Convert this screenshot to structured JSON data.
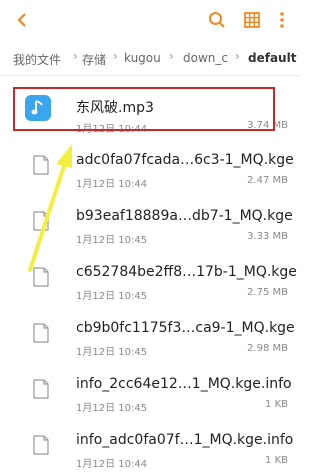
{
  "breadcrumb": {
    "items": [
      "我的文件",
      "存储",
      "kugou",
      "down_c",
      "default"
    ]
  },
  "files": [
    {
      "name": "东风破.mp3",
      "date": "1月12日 10:44",
      "size": "3.74 MB",
      "type": "audio"
    },
    {
      "name": "adc0fa07fcada…6c3-1_MQ.kge",
      "date": "1月12日 10:44",
      "size": "2.47 MB",
      "type": "file"
    },
    {
      "name": "b93eaf18889a…db7-1_MQ.kge",
      "date": "1月12日 10:45",
      "size": "3.33 MB",
      "type": "file"
    },
    {
      "name": "c652784be2ff8…17b-1_MQ.kge",
      "date": "1月12日 10:45",
      "size": "2.75 MB",
      "type": "file"
    },
    {
      "name": "cb9b0fc1175f3…ca9-1_MQ.kge",
      "date": "1月12日 10:45",
      "size": "2.98 MB",
      "type": "file"
    },
    {
      "name": "info_2cc64e12…1_MQ.kge.info",
      "date": "1月12日 10:45",
      "size": "1 KB",
      "type": "file"
    },
    {
      "name": "info_adc0fa07f…1_MQ.kge.info",
      "date": "1月12日 10:44",
      "size": "1 KB",
      "type": "file"
    }
  ],
  "colors": {
    "accent": "#f08a24",
    "highlight": "#c8272b",
    "music_icon": "#3aa6ee",
    "arrow": "#f2ef3d"
  }
}
